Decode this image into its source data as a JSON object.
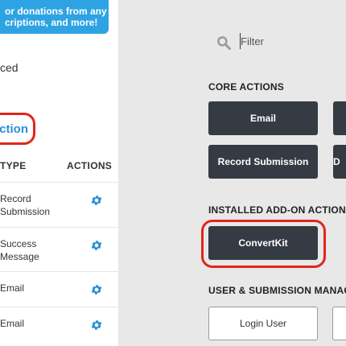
{
  "tooltip": {
    "line1": "or donations from any",
    "line2": "criptions, and more!"
  },
  "left_panel": {
    "advanced_label": "ced",
    "add_action_label": "action",
    "table": {
      "col_type": "TYPE",
      "col_actions": "ACTIONS",
      "rows": [
        {
          "line1": "Record",
          "line2": "Submission"
        },
        {
          "line1": "Success",
          "line2": "Message"
        },
        {
          "line1": "Email",
          "line2": ""
        },
        {
          "line1": "Email",
          "line2": ""
        }
      ]
    }
  },
  "filter": {
    "placeholder": "Filter",
    "icon": "search-icon"
  },
  "sections": {
    "core": {
      "title": "CORE ACTIONS",
      "buttons": [
        "Email",
        "Record Submission"
      ]
    },
    "installed": {
      "title": "INSTALLED ADD-ON ACTIONS",
      "buttons": [
        "ConvertKit"
      ]
    },
    "user": {
      "title": "USER & SUBMISSION MANAGE",
      "buttons": [
        "Login User"
      ]
    }
  },
  "colors": {
    "accent": "#2ea3e3",
    "highlight": "#e1261c",
    "dark_button": "#353b43"
  }
}
